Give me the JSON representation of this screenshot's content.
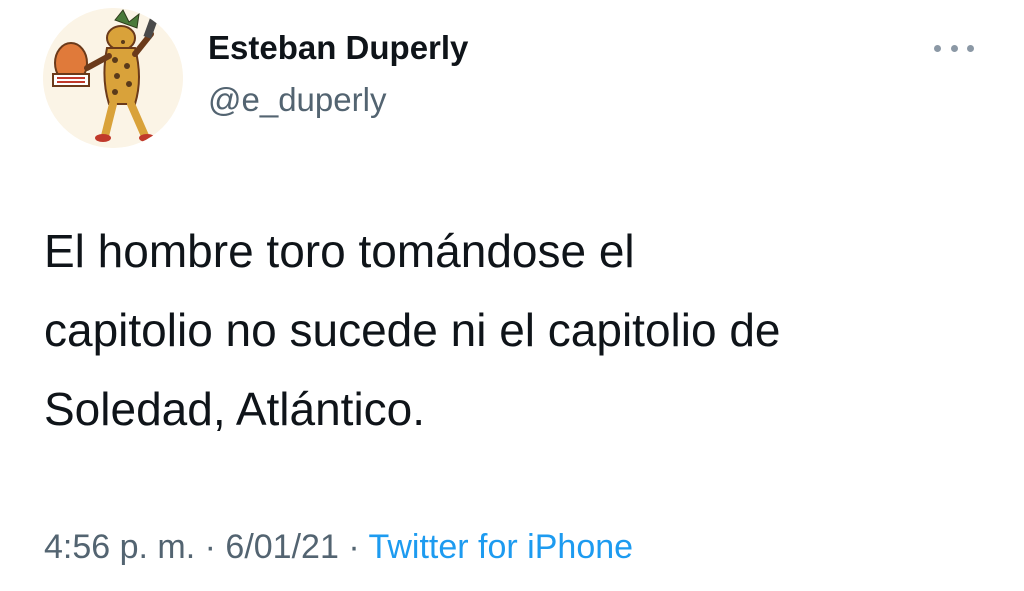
{
  "author": {
    "display_name": "Esteban Duperly",
    "handle": "@e_duperly",
    "avatar_icon": "aztec-jaguar-warrior-avatar"
  },
  "menu": {
    "icon": "more-options-icon"
  },
  "tweet": {
    "lines": [
      "El hombre toro tomándose el",
      "capitolio no sucede ni el capitolio de",
      "Soledad, Atlántico."
    ]
  },
  "meta": {
    "time": "4:56 p. m.",
    "separator": " · ",
    "date": "6/01/21",
    "source": "Twitter for iPhone"
  },
  "colors": {
    "text": "#0f1419",
    "secondary": "#536471",
    "link": "#1d9bf0"
  }
}
